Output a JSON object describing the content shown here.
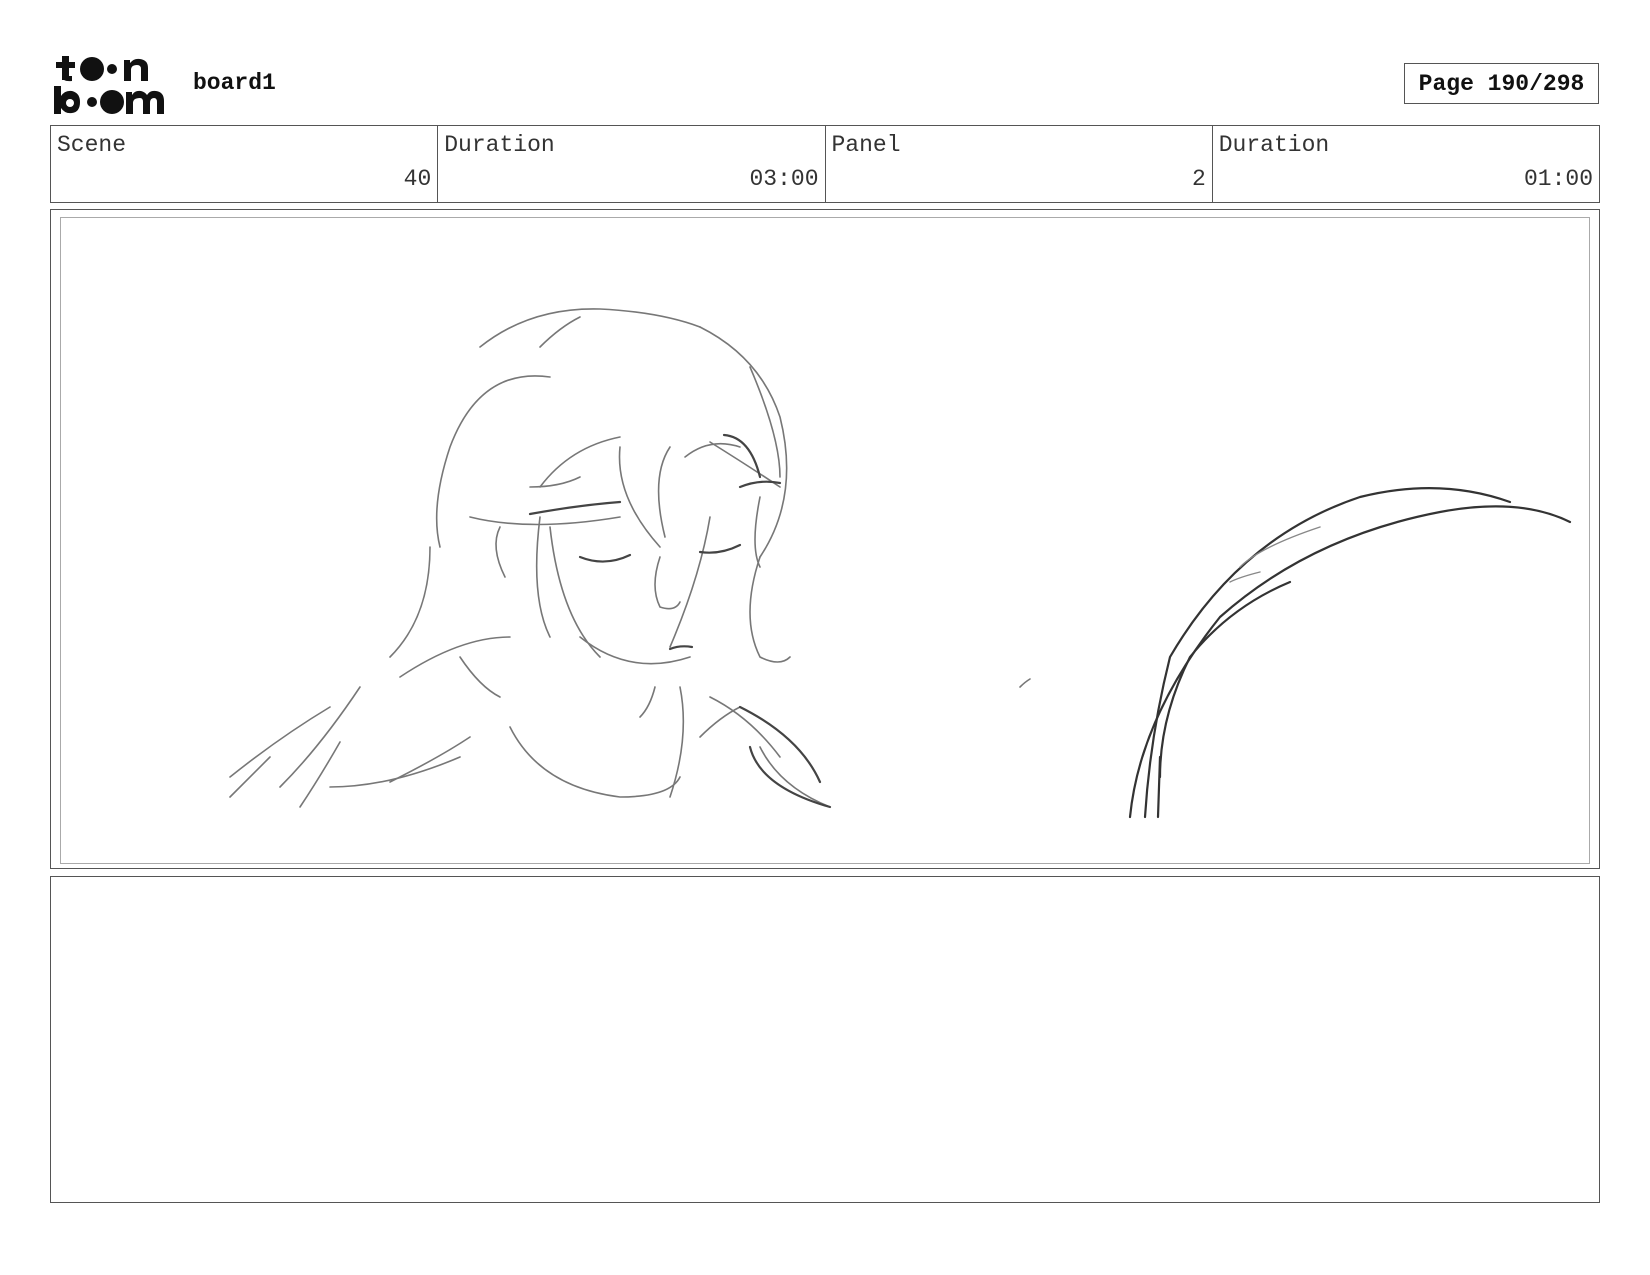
{
  "header": {
    "logo_text": "toon boom",
    "board_title": "board1",
    "page_label": "Page 190/298"
  },
  "info": {
    "scene_label": "Scene",
    "scene_value": "40",
    "scene_duration_label": "Duration",
    "scene_duration_value": "03:00",
    "panel_label": "Panel",
    "panel_value": "2",
    "panel_duration_label": "Duration",
    "panel_duration_value": "01:00"
  },
  "panel": {
    "image_description": "rough pencil sketch of a girl with long hair and closed eyes, large curved shape at right"
  },
  "notes": {
    "text": ""
  }
}
